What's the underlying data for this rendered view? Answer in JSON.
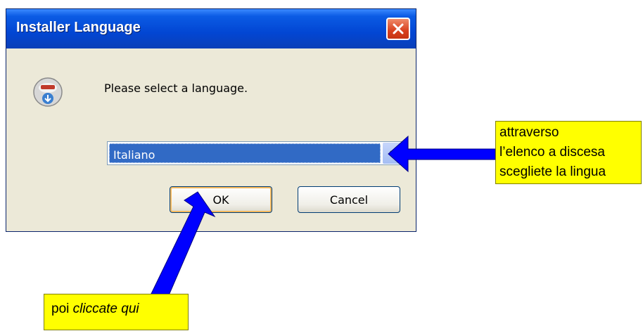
{
  "dialog": {
    "title": "Installer Language",
    "icon": "nsis-installer-icon",
    "prompt": "Please select a language.",
    "language_select": {
      "selected": "Italiano"
    },
    "buttons": {
      "ok": "OK",
      "cancel": "Cancel"
    }
  },
  "annotations": {
    "dropdown_note": [
      "attraverso",
      "l’elenco a discesa",
      "scegliete la lingua"
    ],
    "ok_note": {
      "prefix": "poi ",
      "emphasis": "cliccate qui"
    }
  },
  "colors": {
    "titlebar": "#0246d3",
    "window_face": "#ece9d8",
    "selection": "#316ac5",
    "note": "#ffff00",
    "arrow": "#0000ff"
  }
}
